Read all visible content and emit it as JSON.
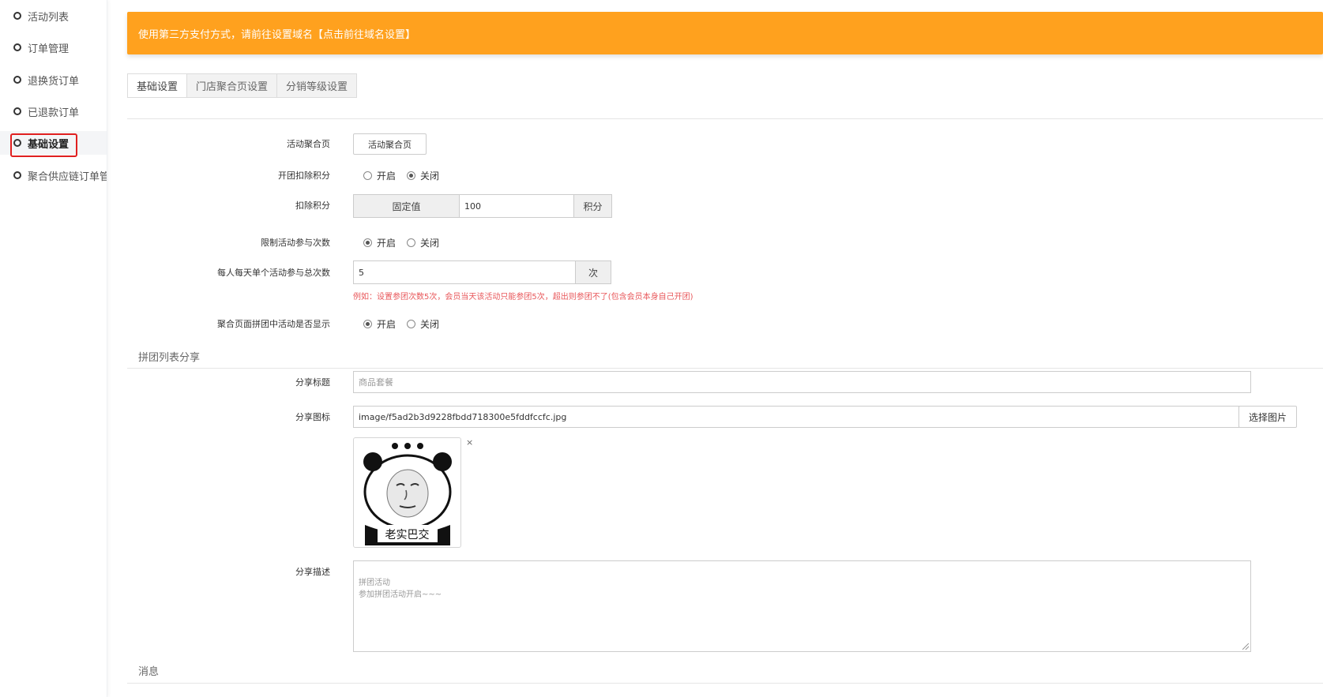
{
  "sidebar": {
    "items": [
      {
        "label": "活动列表",
        "active": false
      },
      {
        "label": "订单管理",
        "active": false
      },
      {
        "label": "退换货订单",
        "active": false
      },
      {
        "label": "已退款订单",
        "active": false
      },
      {
        "label": "基础设置",
        "active": true
      },
      {
        "label": "聚合供应链订单管",
        "active": false
      }
    ]
  },
  "banner": {
    "text": "使用第三方支付方式，请前往设置域名",
    "link": "【点击前往域名设置】",
    "color": "#ffa11e"
  },
  "tabs": [
    {
      "label": "基础设置",
      "active": true
    },
    {
      "label": "门店聚合页设置",
      "active": false
    },
    {
      "label": "分销等级设置",
      "active": false
    }
  ],
  "form": {
    "aggregate_page": {
      "label": "活动聚合页",
      "button": "活动聚合页"
    },
    "deduct_points_toggle": {
      "label": "开团扣除积分",
      "options": [
        "开启",
        "关闭"
      ],
      "selected": "关闭"
    },
    "deduct_points": {
      "label": "扣除积分",
      "prefix": "固定值",
      "value": "100",
      "suffix": "积分"
    },
    "limit_participation": {
      "label": "限制活动参与次数",
      "options": [
        "开启",
        "关闭"
      ],
      "selected": "开启"
    },
    "daily_total": {
      "label": "每人每天单个活动参与总次数",
      "value": "5",
      "suffix": "次",
      "hint": "例如：设置参团次数5次，会员当天该活动只能参团5次，超出则参团不了(包含会员本身自己开团)"
    },
    "show_in_aggregate": {
      "label": "聚合页面拼团中活动是否显示",
      "options": [
        "开启",
        "关闭"
      ],
      "selected": "开启"
    }
  },
  "share_section": {
    "title": "拼团列表分享",
    "share_title": {
      "label": "分享标题",
      "placeholder": "商品套餐"
    },
    "share_icon": {
      "label": "分享图标",
      "value": "image/f5ad2b3d9228fbdd718300e5fddfccfc.jpg",
      "button": "选择图片",
      "thumb_caption": "老实巴交",
      "remove": "×"
    },
    "share_desc": {
      "label": "分享描述",
      "value": "拼团活动\n参加拼团活动开启~~~"
    }
  },
  "message_section": {
    "title": "消息"
  }
}
